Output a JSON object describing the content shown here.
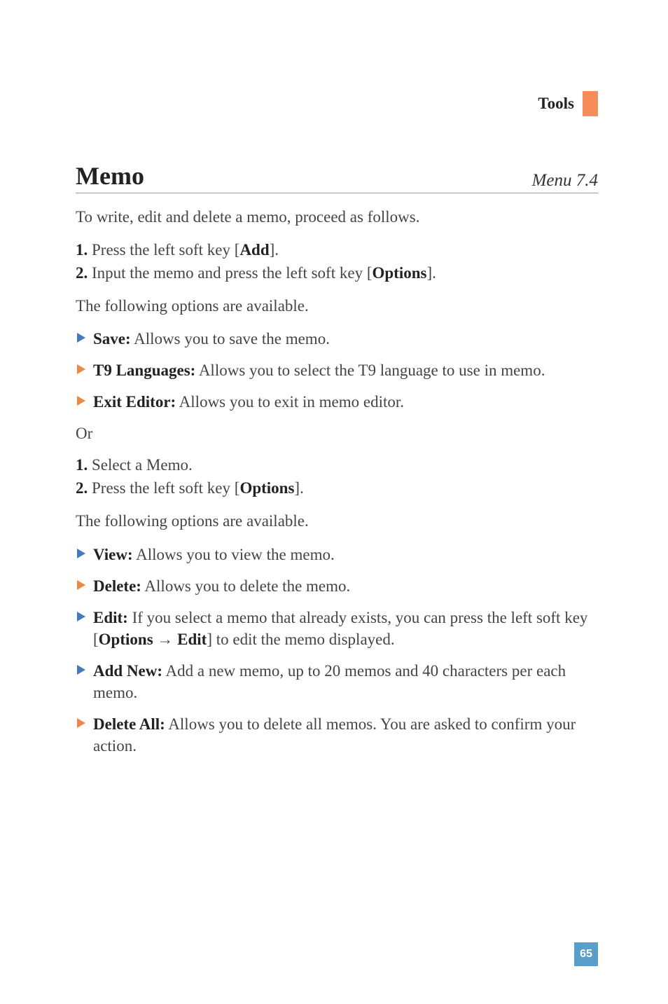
{
  "header": {
    "section_label": "Tools"
  },
  "title": "Memo",
  "menu_ref": "Menu 7.4",
  "intro": "To write, edit and delete a memo, proceed as follows.",
  "steps1": [
    {
      "number": "1.",
      "text_pre": "Press the left soft key [",
      "key": "Add",
      "text_post": "]."
    },
    {
      "number": "2.",
      "text_pre": "Input the memo and press the left soft key [",
      "key": "Options",
      "text_post": "]."
    }
  ],
  "options_intro": "The following options are available.",
  "options1": [
    {
      "color": "blue",
      "label": "Save:",
      "text": " Allows you to save the memo."
    },
    {
      "color": "orange",
      "label": "T9 Languages:",
      "text": " Allows you to select the T9 language to use in memo."
    },
    {
      "color": "orange",
      "label": "Exit Editor:",
      "text": " Allows you to exit in memo editor."
    }
  ],
  "or_label": "Or",
  "steps2": [
    {
      "number": "1.",
      "text_pre": "Select a Memo.",
      "key": "",
      "text_post": ""
    },
    {
      "number": "2.",
      "text_pre": "Press the left soft key [",
      "key": "Options",
      "text_post": "]."
    }
  ],
  "options_intro2": "The following options are available.",
  "options2": [
    {
      "color": "blue",
      "label": "View:",
      "text": " Allows you to view the memo."
    },
    {
      "color": "orange",
      "label": "Delete:",
      "text": " Allows you to delete the memo."
    },
    {
      "color": "blue",
      "label": "Edit:",
      "text_pre": " If you select a memo that already exists, you can press the left soft key [",
      "key1": "Options",
      "arrow": " → ",
      "key2": "Edit",
      "text_post": "] to edit the memo displayed."
    },
    {
      "color": "blue",
      "label": "Add New:",
      "text": " Add a new memo, up to 20 memos and 40 characters per each memo."
    },
    {
      "color": "orange",
      "label": "Delete All:",
      "text": " Allows you to delete all memos. You are asked to confirm your action."
    }
  ],
  "page_number": "65"
}
